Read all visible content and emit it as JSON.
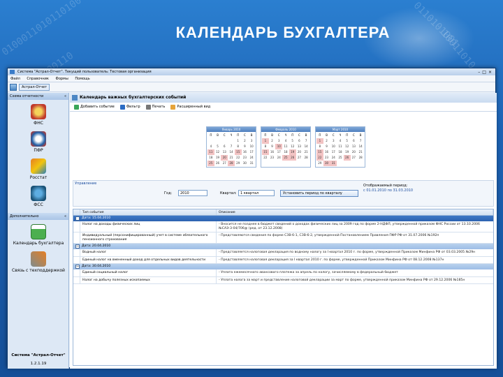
{
  "slide": {
    "title": "КАЛЕНДАРЬ БУХГАЛТЕРА",
    "bg_digits": [
      "0100011010110100",
      "1010100110",
      "0110101001",
      "10011010"
    ]
  },
  "window": {
    "title": "Система \"Астрал-Отчет\". Текущий пользователь: Тестовая организация",
    "menu": [
      "Файл",
      "Справочник",
      "Формы",
      "Помощь"
    ],
    "toolbar_label": "Астрал-Отчет"
  },
  "sidebar": {
    "header": "Схема отчетности",
    "items": [
      {
        "label": "ФНС",
        "icon": "fns-emblem-icon"
      },
      {
        "label": "ПФР",
        "icon": "pfr-emblem-icon"
      },
      {
        "label": "Росстат",
        "icon": "rosstat-emblem-icon"
      },
      {
        "label": "ФСС",
        "icon": "fss-emblem-icon"
      }
    ],
    "header2": "Дополнительно",
    "tools": [
      {
        "label": "Календарь бухгалтера",
        "icon": "calendar-icon"
      },
      {
        "label": "Связь с техподдержкой",
        "icon": "support-tools-icon"
      }
    ],
    "footer": "Система \"Астрал-Отчет\"",
    "version": "1.2.1.19"
  },
  "main": {
    "title": "Календарь важных бухгалтерских событий",
    "toolbar": [
      "Добавить событие",
      "Фильтр",
      "Печать",
      "Расширенный вид"
    ],
    "section_label": "Управление",
    "year_label": "Год:",
    "year_value": "2010",
    "quarter_label": "Квартал:",
    "quarter_value": "1 квартал",
    "apply_button": "Установить период по кварталу",
    "period_label": "Отображаемый период:",
    "period_from": "с 01.01.2010",
    "period_to": "по 31.03.2010",
    "col_event": "Тип события",
    "col_desc": "Описание"
  },
  "calendars": [
    {
      "title": "Январь 2010"
    },
    {
      "title": "Февраль 2010"
    },
    {
      "title": "Март 2010"
    }
  ],
  "weekdays": [
    "П",
    "В",
    "С",
    "Ч",
    "П",
    "С",
    "В"
  ],
  "groups": [
    {
      "date": "Дата: 15.04.2010",
      "selected": true,
      "rows": [
        {
          "event": "Налог на доходы физических лиц",
          "desc": "- Вносится не позднее в бюджет сведений о доходах физических лиц за 2009 год по форме 2-НДФЛ, утвержденной приказом ФНС России от 13.10.2006 №САЭ-3-04/706@ (ред. от 23.12.2008)"
        },
        {
          "event": "Индивидуальный (персонифицированный) учет в системе обязательного пенсионного страхования",
          "desc": "- Представляются сведения по форме СЗВ-6-1, СЗВ-6-2, утвержденной Постановлением Правления ПФР РФ от 31.07.2006 №192п"
        }
      ]
    },
    {
      "date": "Дата: 20.04.2010",
      "selected": false,
      "rows": [
        {
          "event": "Водный налог",
          "desc": "- Представляется налоговая декларация по водному налогу за I квартал 2010 г. по форме, утвержденной Приказом Минфина РФ от 03.03.2005 №29н"
        },
        {
          "event": "Единый налог на вмененный доход для отдельных видов деятельности",
          "desc": "- Представляется налоговая декларация за I квартал 2010 г. по форме, утвержденной Приказом Минфина РФ от 08.12.2008 №137н"
        }
      ]
    },
    {
      "date": "Дата: 30.04.2010",
      "selected": false,
      "rows": [
        {
          "event": "Единый социальный налог",
          "desc": "- Уплата ежемесячного авансового платежа за апрель по налогу, зачисляемому в федеральный бюджет"
        },
        {
          "event": "Налог на добычу полезных ископаемых",
          "desc": "- Уплата налога за март и представление налоговой декларации за март по форме, утвержденной приказом Минфина РФ от 29.12.2006 №185н"
        }
      ]
    }
  ]
}
